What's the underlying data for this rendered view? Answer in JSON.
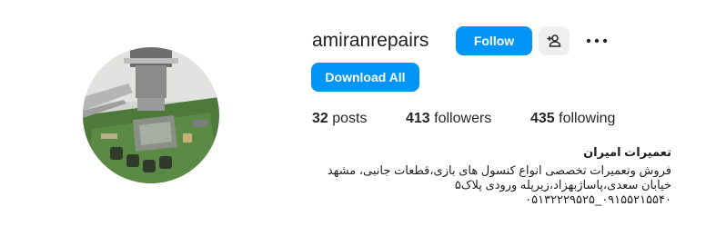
{
  "profile": {
    "username": "amiranrepairs",
    "actions": {
      "follow_label": "Follow",
      "download_label": "Download All"
    },
    "icons": {
      "suggest": "add-person-icon",
      "more": "more-horizontal-icon"
    },
    "stats": {
      "posts": {
        "count": "32",
        "label": "posts"
      },
      "followers": {
        "count": "413",
        "label": "followers"
      },
      "following": {
        "count": "435",
        "label": "following"
      }
    },
    "bio": {
      "name": "تعمیرات امیران",
      "lines": [
        "فروش وتعمیرات تخصصی انواع کنسول های بازی،قطعات جانبی، مشهد",
        "خیابان سعدی،پاساژبهزاد،زیرپله ورودی پلاک۵",
        "۰۹۱۵۵۲۱۵۵۴۰_۰۵۱۳۲۲۲۹۵۲۵"
      ]
    },
    "colors": {
      "primary_button": "#0095f6",
      "secondary_button": "#efefef",
      "text": "#262626"
    }
  }
}
